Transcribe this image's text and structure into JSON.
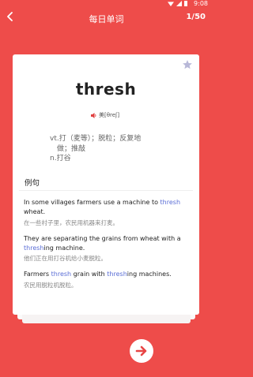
{
  "status_bar": {
    "time": "9:08"
  },
  "header": {
    "title": "每日单词",
    "counter": "1/50"
  },
  "word": {
    "text": "thresh",
    "phonetic": "美[θreʃ]",
    "definitions": [
      "vt.打（麦等）；脱粒；反复地",
      "做；推敲",
      "n.打谷"
    ]
  },
  "examples_section_title": "例句",
  "examples": [
    {
      "en_lines": [
        {
          "parts": [
            "In some villages farmers use a machine to ",
            "thresh"
          ]
        },
        {
          "parts": [
            "wheat."
          ]
        }
      ],
      "zh": "在一些村子里，农民用机器来打麦。"
    },
    {
      "en_lines": [
        {
          "parts": [
            "They are separating the grains from wheat with a"
          ]
        },
        {
          "parts": [
            "",
            "thresh",
            "ing machine."
          ]
        }
      ],
      "zh": "他们正在用打谷机给小麦脱粒。"
    },
    {
      "en_lines": [
        {
          "parts": [
            "Farmers ",
            "thresh",
            " grain with ",
            "thresh",
            "ing machines."
          ]
        }
      ],
      "zh": "农民用脱粒机脱粒。"
    }
  ],
  "colors": {
    "background": "#ee4c4a",
    "highlight": "#5b6ed6",
    "star": "#b8b8d8"
  },
  "icons": [
    "back-arrow-icon",
    "star-icon",
    "speaker-icon",
    "arrow-right-icon",
    "wifi-icon",
    "cellular-icon",
    "battery-icon"
  ]
}
